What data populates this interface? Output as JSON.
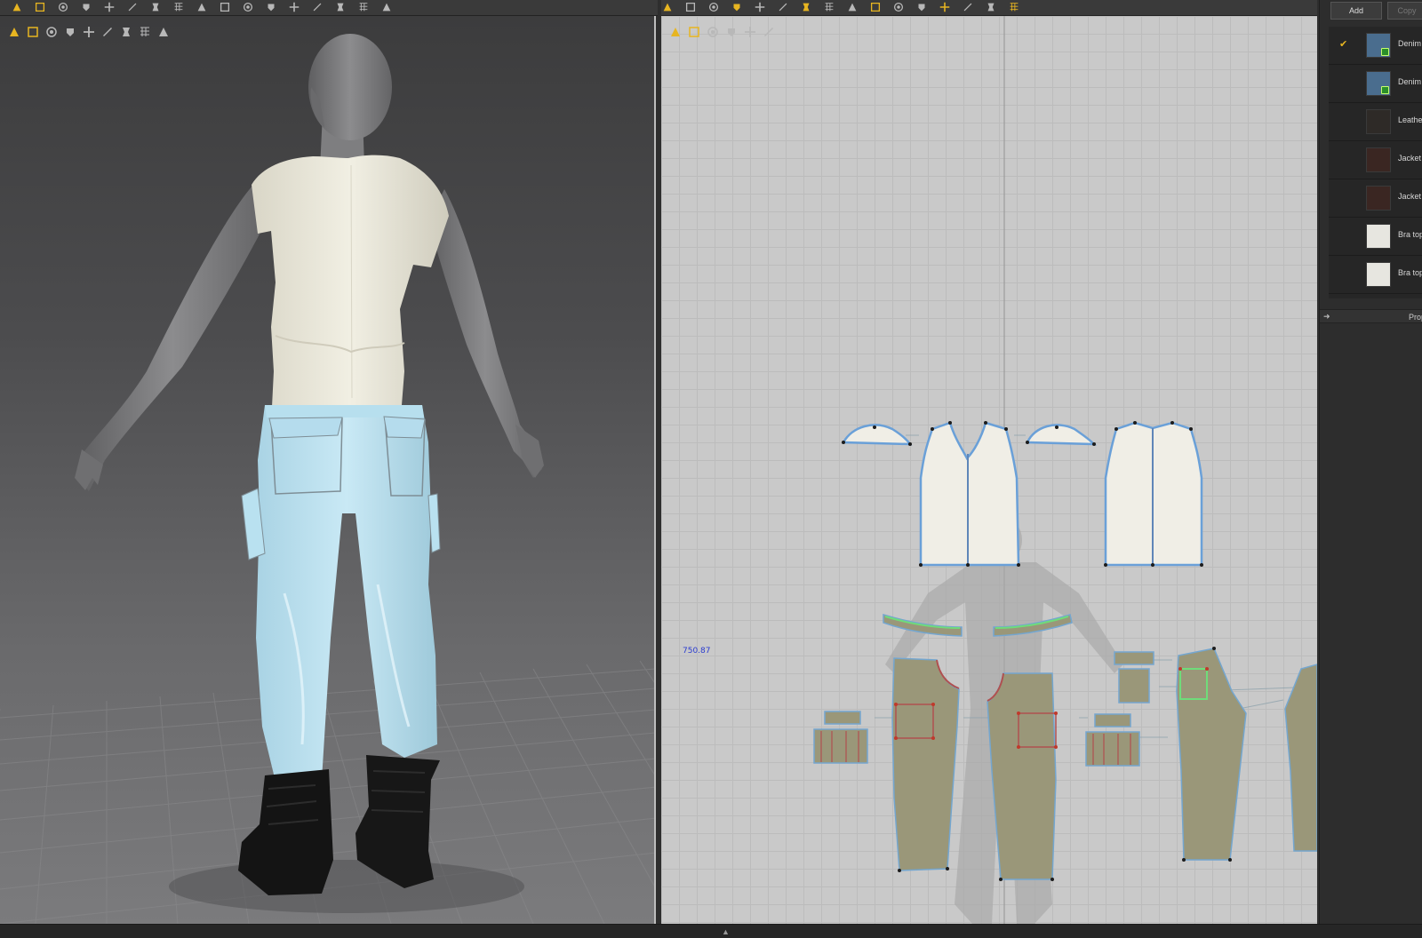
{
  "app": {
    "accent": "#e7b521",
    "panel_bg": "#2d2d2d"
  },
  "toolbar_3d": {
    "icons": [
      "select-move-icon",
      "transform-icon",
      "pin-icon",
      "garment-icon",
      "tack-icon",
      "measure-icon",
      "fold-icon",
      "arrangement-icon",
      "pattern-icon",
      "grid-icon",
      "strap-icon",
      "button-icon",
      "buttonhole-icon",
      "zipper-icon",
      "puckering-icon",
      "avatar-pose-icon",
      "fitting-icon"
    ]
  },
  "viewport3d_toolbar": {
    "icons": [
      "display-avatar-icon",
      "display-garment-icon",
      "texture-icon",
      "avatar-icon",
      "fabric-icon",
      "stress-map-icon",
      "skin-icon",
      "environment-icon",
      "export-icon"
    ]
  },
  "toolbar_2d": {
    "icons": [
      "edit-pattern-icon",
      "transform-pattern-icon",
      "edit-curvature-icon",
      "add-point-icon",
      "polygon-icon",
      "rectangle-icon",
      "internal-polygon-icon",
      "dart-icon",
      "seam-icon",
      "segment-sewing-icon",
      "free-sewing-icon",
      "trace-icon",
      "fold-arrange-icon",
      "grading-icon",
      "symmetry-icon",
      "garment-tool-icon"
    ]
  },
  "viewport2d_toolbar": {
    "icons": [
      "pattern-select-icon",
      "lasso-icon",
      "zoom-icon",
      "fabric-view-icon",
      "avatar-silhouette-icon",
      "export-2d-icon"
    ]
  },
  "viewport2d": {
    "measurement": "750.87"
  },
  "right_panel": {
    "add_label": "Add",
    "copy_label": "Copy",
    "fabrics": [
      {
        "name": "Denim F",
        "color": "#4a6d8e",
        "selected": true,
        "badge": true
      },
      {
        "name": "Denim F",
        "color": "#4a6d8e",
        "selected": false,
        "badge": true
      },
      {
        "name": "Leather",
        "color": "#2e2a27",
        "selected": false,
        "badge": false
      },
      {
        "name": "Jacket l",
        "color": "#3a2622",
        "selected": false,
        "badge": false
      },
      {
        "name": "Jacket t",
        "color": "#3a2622",
        "selected": false,
        "badge": false
      },
      {
        "name": "Bra top",
        "color": "#e7e6e0",
        "selected": false,
        "badge": false
      },
      {
        "name": "Bra top",
        "color": "#e7e6e0",
        "selected": false,
        "badge": false
      }
    ],
    "property_label": "Prop"
  }
}
